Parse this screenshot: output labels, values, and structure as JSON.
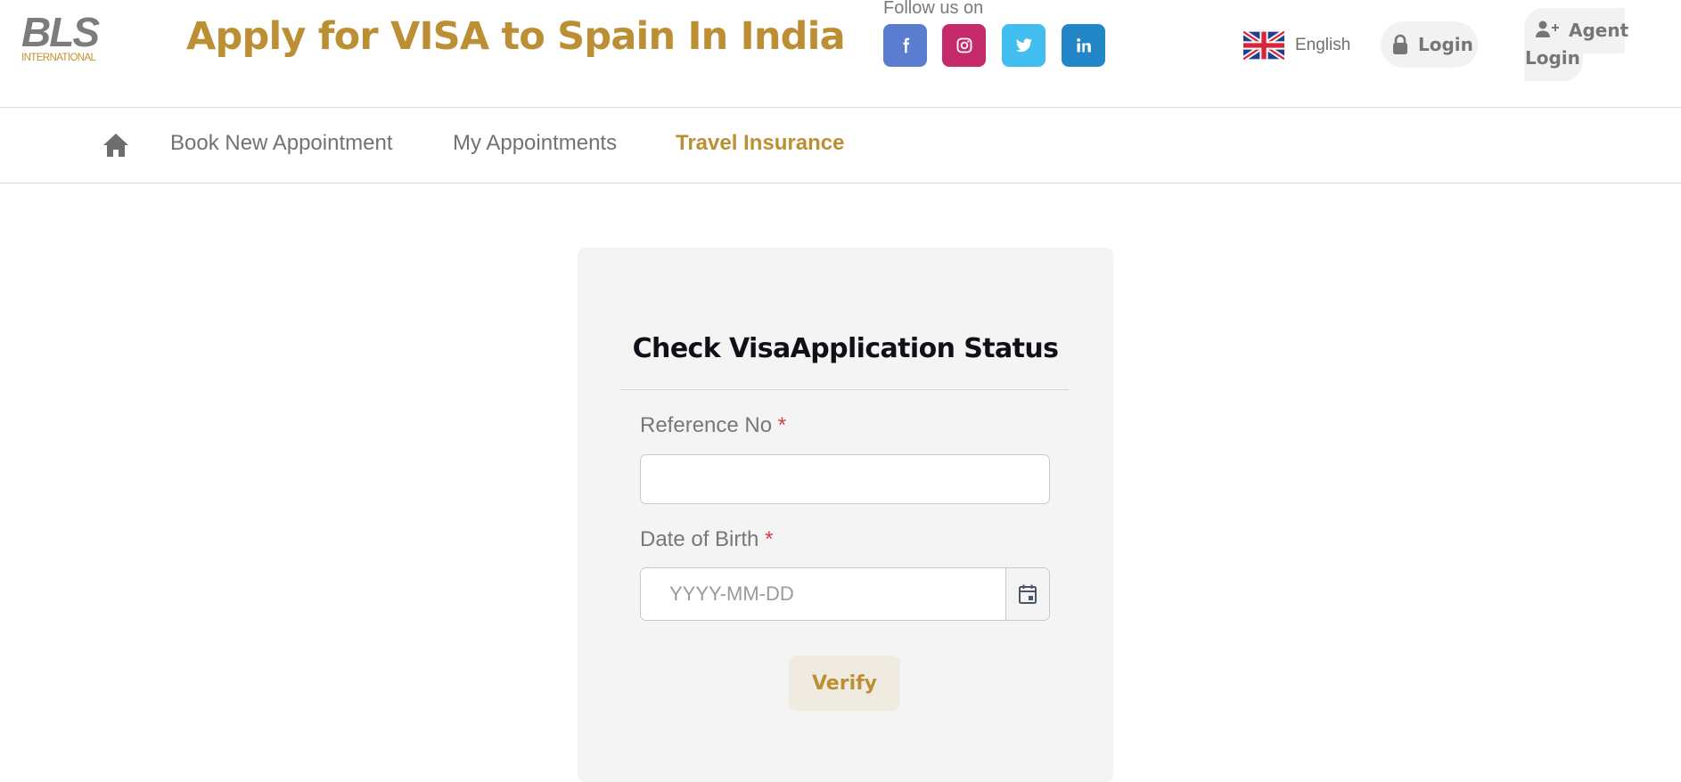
{
  "brand": {
    "logo_main": "BLS",
    "logo_sub": "INTERNATIONAL",
    "site_title": "Apply for VISA to Spain In India",
    "accent_color": "#bd8f34"
  },
  "header": {
    "follow_label": "Follow us on",
    "social": [
      {
        "name": "facebook",
        "icon": "facebook-icon",
        "color": "#5a7dcf"
      },
      {
        "name": "instagram",
        "icon": "instagram-icon",
        "color": "#c52b6c"
      },
      {
        "name": "twitter",
        "icon": "twitter-icon",
        "color": "#42bdf0"
      },
      {
        "name": "linkedin",
        "icon": "linkedin-icon",
        "color": "#2386c6"
      }
    ],
    "language": {
      "icon": "uk-flag-icon",
      "label": "English"
    },
    "login_label": "Login",
    "agent_login_line1": "Agent",
    "agent_login_line2": "Login"
  },
  "nav": {
    "home_icon": "home-icon",
    "items": [
      {
        "label": "Book New Appointment",
        "active": false
      },
      {
        "label": "My Appointments",
        "active": false
      },
      {
        "label": "Travel Insurance",
        "active": true
      }
    ]
  },
  "form": {
    "title": "Check VisaApplication Status",
    "reference": {
      "label": "Reference No",
      "required_mark": "*",
      "value": "",
      "placeholder": ""
    },
    "dob": {
      "label": "Date of Birth",
      "required_mark": "*",
      "value": "",
      "placeholder": "YYYY-MM-DD",
      "icon": "calendar-icon"
    },
    "verify_label": "Verify"
  }
}
